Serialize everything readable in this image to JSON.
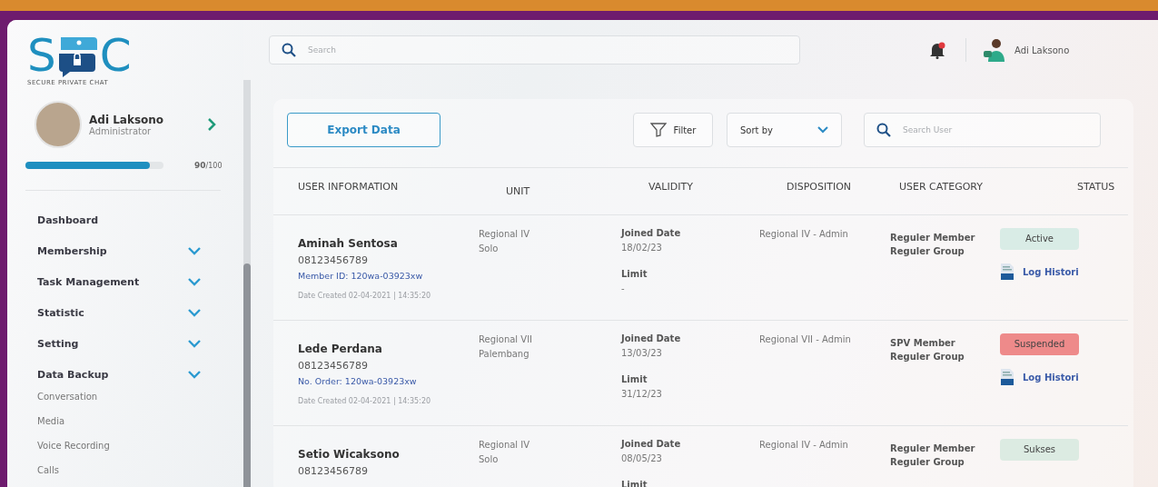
{
  "logo": {
    "left": "S",
    "right": "C",
    "tagline": "SECURE PRIVATE CHAT"
  },
  "profile": {
    "name": "Adi Laksono",
    "role": "Administrator",
    "level": 0.9,
    "score": "90",
    "score_max": "/100"
  },
  "sidebar": {
    "items": [
      {
        "label": "Dashboard",
        "kind": "link"
      },
      {
        "label": "Membership",
        "kind": "group"
      },
      {
        "label": "Task Management",
        "kind": "group"
      },
      {
        "label": "Statistic",
        "kind": "group"
      },
      {
        "label": "Setting",
        "kind": "group"
      },
      {
        "label": "Data Backup",
        "kind": "group",
        "children": [
          {
            "label": "Conversation"
          },
          {
            "label": "Media"
          },
          {
            "label": "Voice Recording"
          },
          {
            "label": "Calls"
          }
        ]
      }
    ]
  },
  "topbar": {
    "search": {
      "placeholder": "Search"
    },
    "user": "Adi Laksono"
  },
  "toolbar": {
    "export": "Export Data",
    "filter": "Filter",
    "sort": "Sort by",
    "search": {
      "placeholder": "Search User"
    }
  },
  "table": {
    "columns": [
      "USER INFORMATION",
      "UNIT",
      "VALIDITY",
      "DISPOSITION",
      "USER CATEGORY",
      "STATUS"
    ],
    "rows": [
      {
        "name": "Aminah Sentosa",
        "phone": "08123456789",
        "id": "Member ID: 120wa-03923xw",
        "created": "Date Created 02-04-2021 | 14:35:20",
        "unit": [
          "Regional IV",
          "Solo"
        ],
        "joined_label": "Joined Date",
        "joined": "18/02/23",
        "limit_label": "Limit",
        "limit": "-",
        "disposition": "Regional IV - Admin",
        "category": [
          "Reguler Member",
          "Reguler Group"
        ],
        "status": "Active",
        "color": "#d9ece6",
        "log": "Log Histori"
      },
      {
        "name": "Lede Perdana",
        "phone": "08123456789",
        "id": "No. Order: 120wa-03923xw",
        "created": "Date Created 02-04-2021 | 14:35:20",
        "unit": [
          "Regional VII",
          "Palembang"
        ],
        "joined_label": "Joined Date",
        "joined": "13/03/23",
        "limit_label": "Limit",
        "limit": "31/12/23",
        "disposition": "Regional VII - Admin",
        "category": [
          "SPV Member",
          "Reguler Group"
        ],
        "status": "Suspended",
        "color": "#ee8a8a",
        "log": "Log Histori"
      },
      {
        "name": "Setio Wicaksono",
        "phone": "08123456789",
        "unit": [
          "Regional IV",
          "Solo"
        ],
        "joined_label": "Joined Date",
        "joined": "08/05/23",
        "limit_label": "Limit",
        "disposition": "Regional IV - Admin",
        "category": [
          "Reguler Member",
          "Reguler Group"
        ],
        "status": "Sukses",
        "color": "#dcebe2"
      }
    ]
  }
}
